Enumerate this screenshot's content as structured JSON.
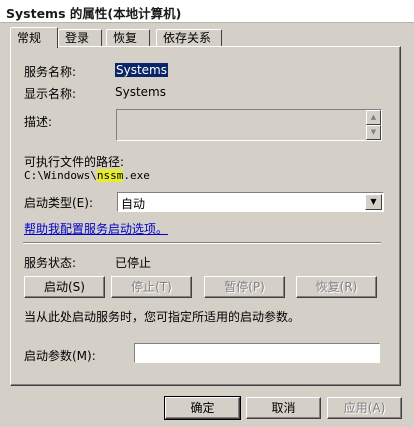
{
  "window": {
    "title": "Systems 的属性(本地计算机)"
  },
  "tabs": [
    {
      "label": "常规"
    },
    {
      "label": "登录"
    },
    {
      "label": "恢复"
    },
    {
      "label": "依存关系"
    }
  ],
  "general": {
    "service_name_label": "服务名称:",
    "service_name_value": "Systems",
    "display_name_label": "显示名称:",
    "display_name_value": "Systems",
    "description_label": "描述:",
    "description_value": "",
    "exe_path_label": "可执行文件的路径:",
    "exe_path_prefix": "C:\\Windows\\",
    "exe_path_highlight": "nssm",
    "exe_path_suffix": ".exe",
    "highlight_color": "#e6ec31",
    "startup_type_label": "启动类型(E):",
    "startup_type_value": "自动",
    "help_link": "帮助我配置服务启动选项。",
    "status_label": "服务状态:",
    "status_value": "已停止",
    "btn_start": "启动(S)",
    "btn_stop": "停止(T)",
    "btn_pause": "暂停(P)",
    "btn_resume": "恢复(R)",
    "hint": "当从此处启动服务时，您可指定所适用的启动参数。",
    "params_label": "启动参数(M):",
    "params_value": ""
  },
  "footer": {
    "ok": "确定",
    "cancel": "取消",
    "apply": "应用(A)"
  }
}
